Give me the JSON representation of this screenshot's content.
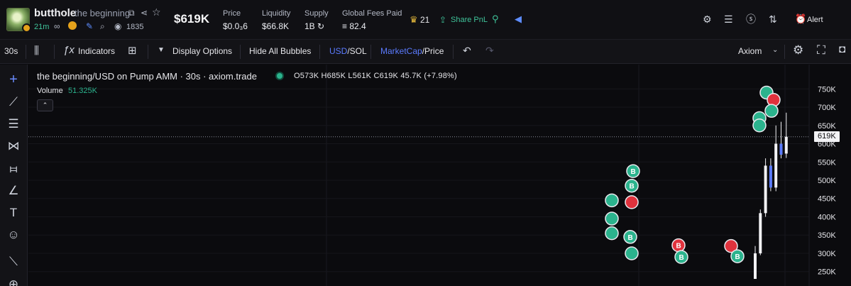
{
  "header": {
    "symbol": "butthole",
    "name": "the beginning",
    "age": "21m",
    "watchers": "1835",
    "market_cap": "$619K",
    "stats": [
      {
        "label": "Price",
        "value": "$0.0₃6"
      },
      {
        "label": "Liquidity",
        "value": "$66.8K"
      },
      {
        "label": "Supply",
        "value": "1B ↻"
      },
      {
        "label": "Global Fees Paid",
        "value": "≡ 82.4"
      }
    ],
    "holders": "21",
    "share_pnl": "Share PnL",
    "alert": "Alert",
    "icons": [
      "copy-icon",
      "share-icon",
      "star-icon",
      "link-icon",
      "coin-icon",
      "pencil-icon",
      "search-icon",
      "eye-icon",
      "crown-icon",
      "pin-icon",
      "megaphone-icon",
      "settings-icon",
      "list-icon",
      "dollar-icon",
      "swap-icon",
      "bell-icon"
    ]
  },
  "toolbar": {
    "timeframe": "30s",
    "indicators": "Indicators",
    "display_options": "Display Options",
    "hide_bubbles": "Hide All Bubbles",
    "currency_active": "USD",
    "currency_other": "/SOL",
    "mode_active": "MarketCap",
    "mode_other": "/Price",
    "theme": "Axiom"
  },
  "colors": {
    "background": "#0b0b0e",
    "up": "#2bb38d",
    "down": "#e0323d",
    "accent_blue": "#5b7bff",
    "candle_body": "#f2f2f5"
  },
  "chart": {
    "legend_title": "the beginning/USD on Pump AMM · 30s · axiom.trade",
    "ohlc": "O573K  H685K  L561K  C619K  45.7K (+7.98%)",
    "volume_label": "Volume",
    "volume_value": "51.325K",
    "collapse_label": "⌃",
    "current_price_label": "619K"
  },
  "chart_data": {
    "type": "line",
    "title": "the beginning/USD on Pump AMM · 30s · axiom.trade",
    "ylabel": "",
    "ylim": [
      230000,
      770000
    ],
    "yticks": [
      250000,
      300000,
      350000,
      400000,
      450000,
      500000,
      550000,
      600000,
      650000,
      700000,
      750000
    ],
    "ytick_labels": [
      "250K",
      "300K",
      "350K",
      "400K",
      "450K",
      "500K",
      "550K",
      "600K",
      "650K",
      "700K",
      "750K"
    ],
    "current_value": 619000,
    "ohlc_last": {
      "open": 573000,
      "high": 685000,
      "low": 561000,
      "close": 619000,
      "change": "45.7K",
      "change_pct": 7.98
    },
    "candles": [
      {
        "o": 230000,
        "h": 320000,
        "l": 230000,
        "c": 300000
      },
      {
        "o": 300000,
        "h": 420000,
        "l": 295000,
        "c": 410000
      },
      {
        "o": 410000,
        "h": 560000,
        "l": 400000,
        "c": 540000
      },
      {
        "o": 540000,
        "h": 560000,
        "l": 470000,
        "c": 480000
      },
      {
        "o": 480000,
        "h": 650000,
        "l": 470000,
        "c": 600000
      },
      {
        "o": 600000,
        "h": 660000,
        "l": 560000,
        "c": 570000
      },
      {
        "o": 573000,
        "h": 685000,
        "l": 561000,
        "c": 619000
      }
    ],
    "trade_bubbles": [
      {
        "value": 525000,
        "side": "buy",
        "label": "B"
      },
      {
        "value": 485000,
        "side": "buy",
        "label": "B"
      },
      {
        "value": 445000,
        "side": "buy",
        "label": ""
      },
      {
        "value": 440000,
        "side": "sell",
        "label": ""
      },
      {
        "value": 395000,
        "side": "buy",
        "label": ""
      },
      {
        "value": 355000,
        "side": "buy",
        "label": ""
      },
      {
        "value": 345000,
        "side": "buy",
        "label": "B"
      },
      {
        "value": 322000,
        "side": "sell",
        "label": "B"
      },
      {
        "value": 300000,
        "side": "buy",
        "label": ""
      },
      {
        "value": 290000,
        "side": "buy",
        "label": "B"
      },
      {
        "value": 320000,
        "side": "sell",
        "label": ""
      },
      {
        "value": 292000,
        "side": "buy",
        "label": "B"
      },
      {
        "value": 740000,
        "side": "buy",
        "label": ""
      },
      {
        "value": 720000,
        "side": "sell",
        "label": ""
      },
      {
        "value": 690000,
        "side": "buy",
        "label": ""
      },
      {
        "value": 670000,
        "side": "buy",
        "label": ""
      },
      {
        "value": 650000,
        "side": "buy",
        "label": ""
      }
    ]
  }
}
